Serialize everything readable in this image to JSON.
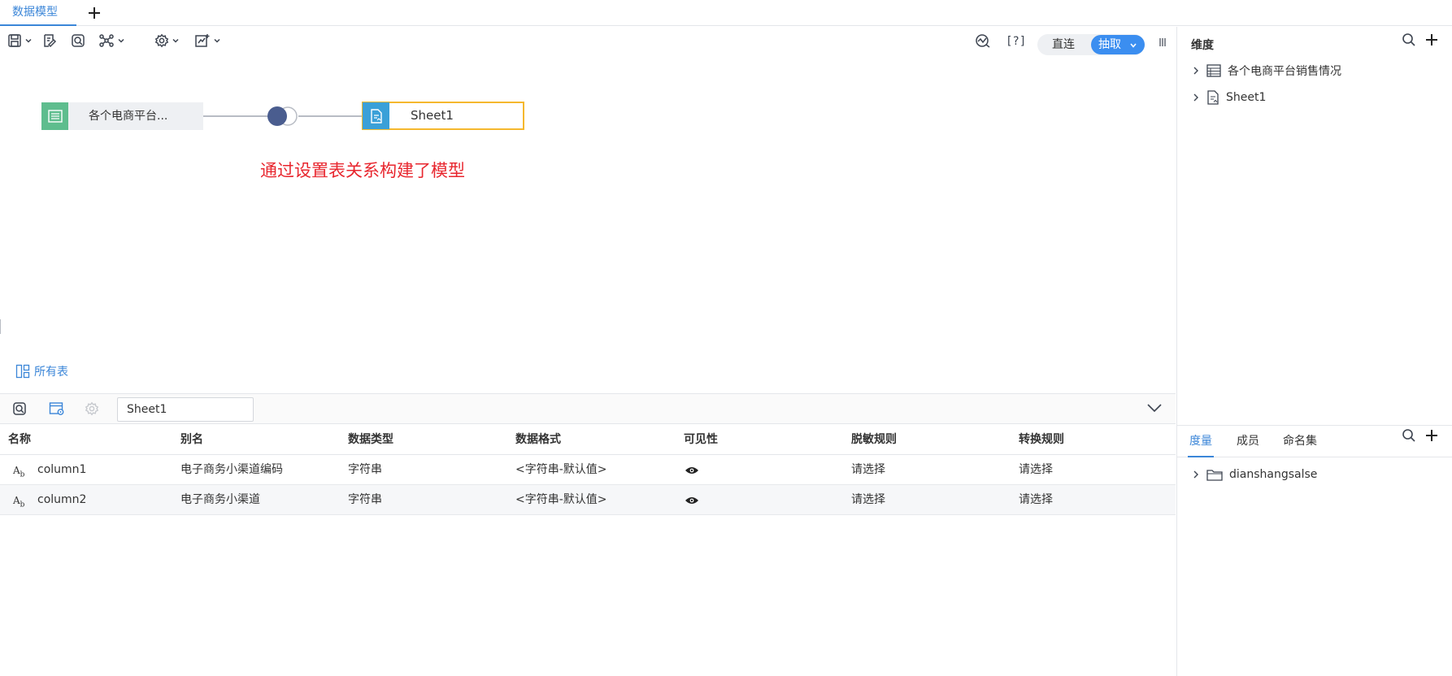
{
  "tabs": {
    "active": "数据模型"
  },
  "toolbar": {
    "icons": [
      "save-icon",
      "edit-icon",
      "preview-icon",
      "relation-icon",
      "settings-icon",
      "chart-icon",
      "monitor-icon",
      "help-icon",
      "columns-icon"
    ],
    "help_text": "[?]",
    "mode_direct": "直连",
    "mode_extract": "抽取"
  },
  "canvas": {
    "node1_label": "各个电商平台...",
    "node2_label": "Sheet1",
    "annotation": "通过设置表关系构建了模型",
    "all_tables": "所有表"
  },
  "fieldbar": {
    "table_name": "Sheet1"
  },
  "grid": {
    "columns": [
      "名称",
      "别名",
      "数据类型",
      "数据格式",
      "可见性",
      "脱敏规则",
      "转换规则"
    ],
    "rows": [
      {
        "name": "column1",
        "alias": "电子商务小渠道编码",
        "type": "字符串",
        "format": "<字符串-默认值>",
        "visible": "eye-icon",
        "mask": "请选择",
        "convert": "请选择"
      },
      {
        "name": "column2",
        "alias": "电子商务小渠道",
        "type": "字符串",
        "format": "<字符串-默认值>",
        "visible": "eye-icon",
        "mask": "请选择",
        "convert": "请选择"
      }
    ]
  },
  "right_panel": {
    "title": "维度",
    "dimensions": [
      {
        "label": "各个电商平台销售情况",
        "icon": "table-icon"
      },
      {
        "label": "Sheet1",
        "icon": "sheet-icon"
      }
    ],
    "tabs": [
      "度量",
      "成员",
      "命名集"
    ],
    "active_tab": "度量",
    "measures": [
      {
        "label": "dianshangsalse",
        "icon": "folder-icon"
      }
    ]
  },
  "colors": {
    "accent": "#3b86d8",
    "annotation": "#e8262e",
    "node_border": "#f5b82e",
    "table_icon_bg": "#5ebd8e",
    "sheet_icon_bg": "#3aa0d8"
  }
}
